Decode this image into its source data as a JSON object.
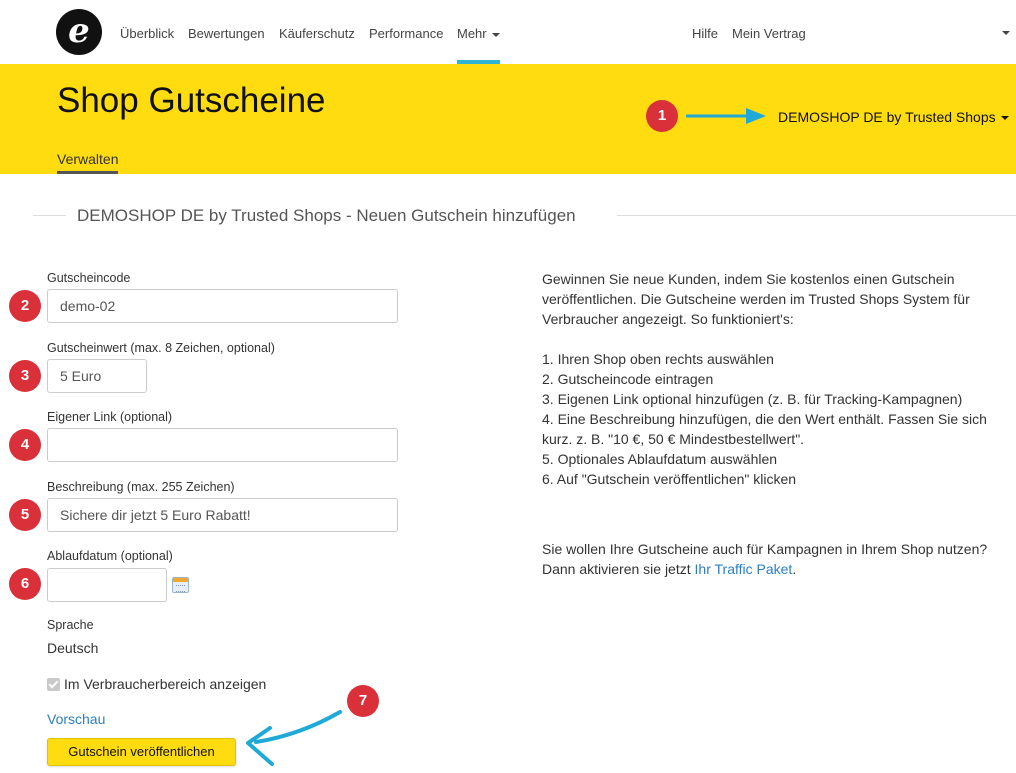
{
  "nav": {
    "items": [
      {
        "label": "Überblick"
      },
      {
        "label": "Bewertungen"
      },
      {
        "label": "Käuferschutz"
      },
      {
        "label": "Performance"
      },
      {
        "label": "Mehr"
      }
    ],
    "help": "Hilfe",
    "contract": "Mein Vertrag",
    "active_bar_color": "#2eb5d6"
  },
  "header": {
    "title": "Shop Gutscheine",
    "tab": "Verwalten",
    "shop_selector": "DEMOSHOP DE by Trusted Shops",
    "background_color": "#ffdc0f"
  },
  "section_title": "DEMOSHOP DE by Trusted Shops - Neuen Gutschein hinzufügen",
  "form": {
    "code_label": "Gutscheincode",
    "code_value": "demo-02",
    "value_label": "Gutscheinwert (max. 8 Zeichen, optional)",
    "value_value": "5 Euro",
    "link_label": "Eigener Link (optional)",
    "link_value": "",
    "description_label": "Beschreibung (max. 255 Zeichen)",
    "description_value": "Sichere dir jetzt 5 Euro Rabatt!",
    "expiry_label": "Ablaufdatum (optional)",
    "expiry_value": "",
    "language_label": "Sprache",
    "language_value": "Deutsch",
    "consumer_area_label": "Im Verbraucherbereich anzeigen",
    "preview_link": "Vorschau",
    "publish_button": "Gutschein veröffentlichen"
  },
  "info": {
    "intro": "Gewinnen Sie neue Kunden, indem Sie kostenlos einen Gutschein veröffentlichen. Die Gutscheine werden im Trusted Shops System für Verbraucher angezeigt. So funktioniert's:",
    "steps": [
      "1. Ihren Shop oben rechts auswählen",
      "2. Gutscheincode eintragen",
      "3. Eigenen Link optional hinzufügen (z. B. für Tracking-Kampagnen)",
      "4. Eine Beschreibung hinzufügen, die den Wert enthält. Fassen Sie sich kurz. z. B. \"10 €, 50 € Mindestbestellwert\".",
      "5. Optionales Ablaufdatum auswählen",
      "6. Auf \"Gutschein veröffentlichen\" klicken"
    ],
    "campaign_question": "Sie wollen Ihre Gutscheine auch für Kampagnen in Ihrem Shop nutzen?",
    "campaign_prefix": "Dann aktivieren sie jetzt ",
    "campaign_link": "Ihr Traffic Paket",
    "campaign_suffix": "."
  },
  "annotations": {
    "badges": [
      "1",
      "2",
      "3",
      "4",
      "5",
      "6",
      "7"
    ],
    "badge_color": "#d9303a",
    "arrow_color": "#1fa9d6"
  }
}
